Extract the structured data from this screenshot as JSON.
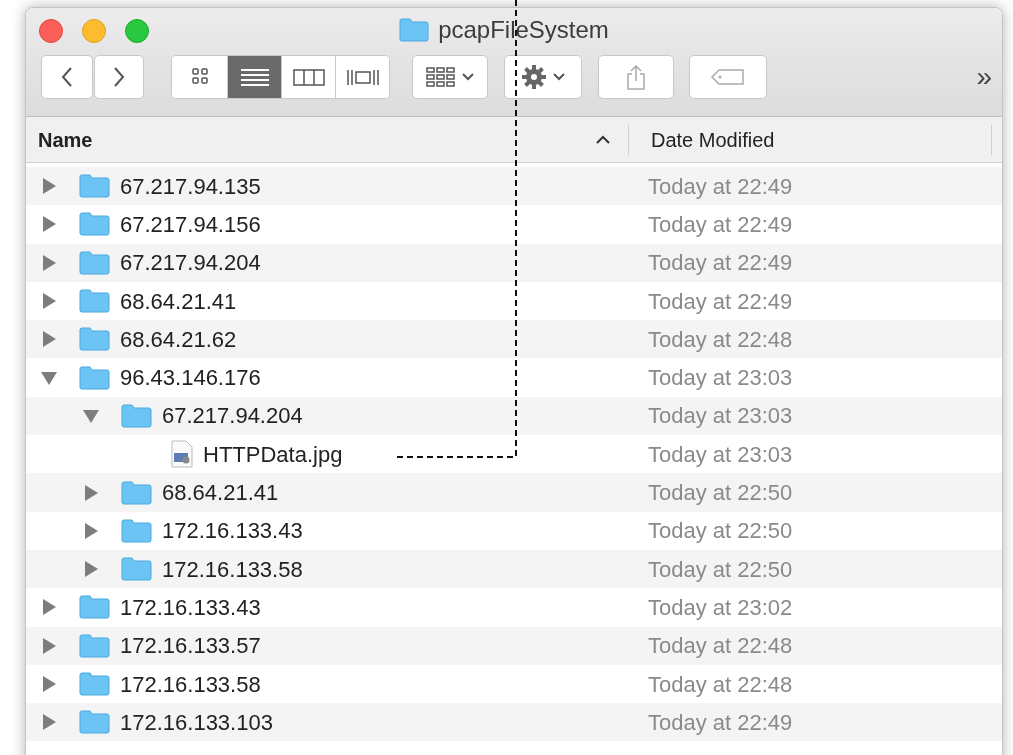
{
  "window": {
    "title": "pcapFileSystem"
  },
  "toolbar": {
    "view_modes": [
      {
        "selected": false
      },
      {
        "selected": true
      },
      {
        "selected": false
      },
      {
        "selected": false
      }
    ],
    "overflow": "»"
  },
  "columns": [
    {
      "label": "Name",
      "sorted": true
    },
    {
      "label": "Date Modified",
      "sorted": false
    }
  ],
  "items": [
    {
      "kind": "folder",
      "name": "67.217.94.135",
      "modified": "Today at 22:49",
      "expanded": false
    },
    {
      "kind": "folder",
      "name": "67.217.94.156",
      "modified": "Today at 22:49",
      "expanded": false
    },
    {
      "kind": "folder",
      "name": "67.217.94.204",
      "modified": "Today at 22:49",
      "expanded": false
    },
    {
      "kind": "folder",
      "name": "68.64.21.41",
      "modified": "Today at 22:49",
      "expanded": false
    },
    {
      "kind": "folder",
      "name": "68.64.21.62",
      "modified": "Today at 22:48",
      "expanded": false
    },
    {
      "kind": "folder",
      "name": "96.43.146.176",
      "modified": "Today at 23:03",
      "expanded": true,
      "children": [
        {
          "kind": "folder",
          "name": "67.217.94.204",
          "modified": "Today at 23:03",
          "expanded": true,
          "children": [
            {
              "kind": "file",
              "name": "HTTPData.jpg",
              "modified": "Today at 23:03"
            }
          ]
        },
        {
          "kind": "folder",
          "name": "68.64.21.41",
          "modified": "Today at 22:50",
          "expanded": false
        },
        {
          "kind": "folder",
          "name": "172.16.133.43",
          "modified": "Today at 22:50",
          "expanded": false
        },
        {
          "kind": "folder",
          "name": "172.16.133.58",
          "modified": "Today at 22:50",
          "expanded": false
        }
      ]
    },
    {
      "kind": "folder",
      "name": "172.16.133.43",
      "modified": "Today at 23:02",
      "expanded": false
    },
    {
      "kind": "folder",
      "name": "172.16.133.57",
      "modified": "Today at 22:48",
      "expanded": false
    },
    {
      "kind": "folder",
      "name": "172.16.133.58",
      "modified": "Today at 22:48",
      "expanded": false
    },
    {
      "kind": "folder",
      "name": "172.16.133.103",
      "modified": "Today at 22:49",
      "expanded": false
    }
  ]
}
